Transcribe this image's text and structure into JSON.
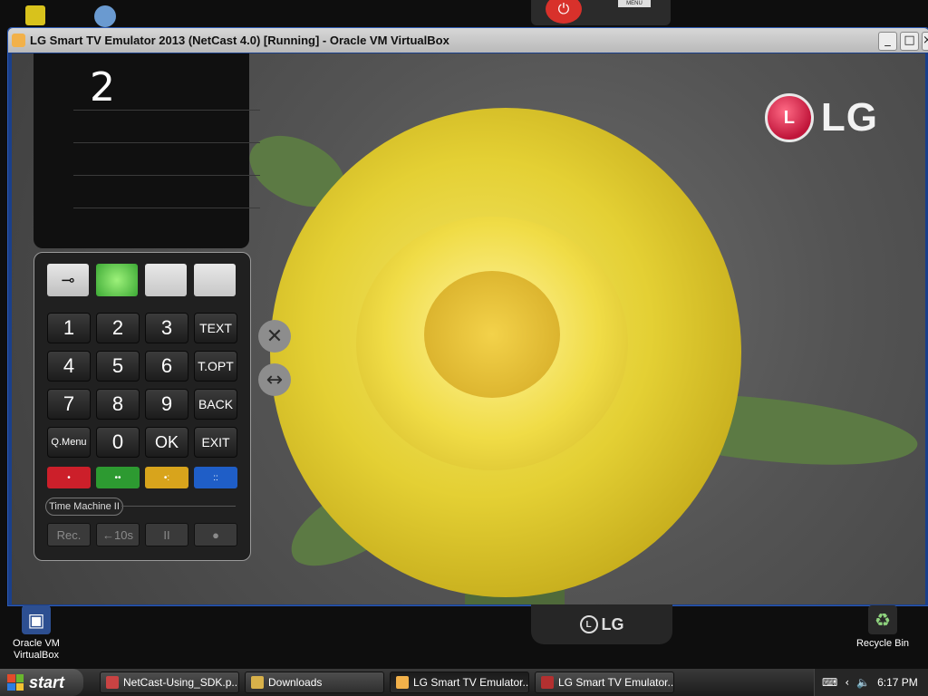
{
  "desktop": {
    "icons": [
      {
        "label": "Oracle VM\nVirtualBox",
        "icon": "virtualbox-icon"
      },
      {
        "label": "Recycle Bin",
        "icon": "recycle-bin-icon"
      }
    ],
    "top_remote": {
      "power_icon": "power-icon",
      "menu_label": "MENU"
    },
    "bottom_remote": {
      "logo_text": "LG"
    }
  },
  "window": {
    "title": "LG Smart TV Emulator 2013 (NetCast 4.0) [Running] - Oracle VM VirtualBox",
    "controls": [
      "minimize",
      "maximize",
      "close"
    ]
  },
  "tv": {
    "brand": "LG",
    "brand_logo_mark": "L",
    "channel_display": "2"
  },
  "remote": {
    "top_keys": [
      "input-icon",
      "green",
      "gray",
      "gray"
    ],
    "rows": [
      [
        "1",
        "2",
        "3",
        "TEXT"
      ],
      [
        "4",
        "5",
        "6",
        "T.OPT"
      ],
      [
        "7",
        "8",
        "9",
        "BACK"
      ],
      [
        "Q.Menu",
        "0",
        "OK",
        "EXIT"
      ]
    ],
    "color_keys": [
      {
        "color": "#cc1f2a",
        "dots": "•"
      },
      {
        "color": "#2d9a31",
        "dots": "••"
      },
      {
        "color": "#d8a41c",
        "dots": "•:"
      },
      {
        "color": "#1f5ec7",
        "dots": "::"
      }
    ],
    "time_machine_label": "Time Machine II",
    "time_machine_keys": [
      "Rec.",
      "←10s",
      "II",
      "●"
    ],
    "side_controls": [
      "close-icon",
      "resize-icon"
    ]
  },
  "taskbar": {
    "start_label": "start",
    "tasks": [
      {
        "label": "NetCast-Using_SDK.p...",
        "icon": "pdf-icon",
        "active": false
      },
      {
        "label": "Downloads",
        "icon": "folder-icon",
        "active": false
      },
      {
        "label": "LG Smart TV Emulator...",
        "icon": "virtualbox-icon",
        "active": true
      },
      {
        "label": "LG Smart TV Emulator...",
        "icon": "emulator-icon",
        "active": false
      }
    ],
    "clock": "6:17 PM"
  },
  "colors": {
    "power": "#d8312b",
    "lg_red": "#c0153a",
    "rose_yellow": "#e6d23a"
  }
}
